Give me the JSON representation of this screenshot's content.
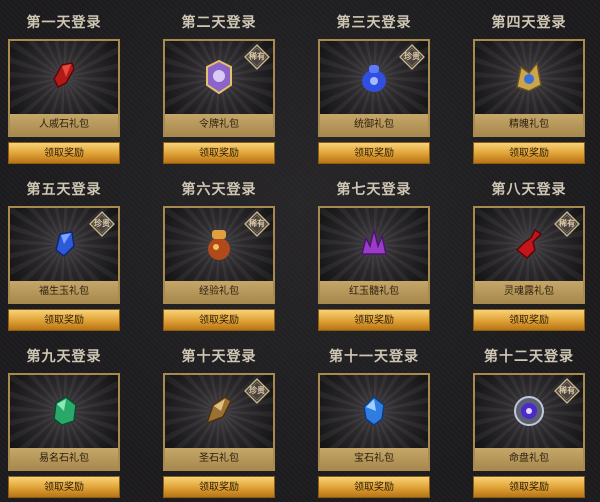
{
  "rewards": [
    {
      "day": "第一天登录",
      "item": "人戚石礼包",
      "badge": "",
      "icon": "red-gem-icon",
      "claim": "领取奖励"
    },
    {
      "day": "第二天登录",
      "item": "令牌礼包",
      "badge": "稀有",
      "icon": "token-icon",
      "claim": "领取奖励"
    },
    {
      "day": "第三天登录",
      "item": "统御礼包",
      "badge": "珍贵",
      "icon": "blue-pouch-icon",
      "claim": "领取奖励"
    },
    {
      "day": "第四天登录",
      "item": "精魄礼包",
      "badge": "",
      "icon": "golden-spirit-icon",
      "claim": "领取奖励"
    },
    {
      "day": "第五天登录",
      "item": "福生玉礼包",
      "badge": "珍贵",
      "icon": "blue-jade-icon",
      "claim": "领取奖励"
    },
    {
      "day": "第六天登录",
      "item": "经验礼包",
      "badge": "稀有",
      "icon": "exp-jar-icon",
      "claim": "领取奖励"
    },
    {
      "day": "第七天登录",
      "item": "红玉髓礼包",
      "badge": "",
      "icon": "purple-crystal-icon",
      "claim": "领取奖励"
    },
    {
      "day": "第八天登录",
      "item": "灵魂露礼包",
      "badge": "稀有",
      "icon": "red-bottle-icon",
      "claim": "领取奖励"
    },
    {
      "day": "第九天登录",
      "item": "易名石礼包",
      "badge": "",
      "icon": "green-stone-icon",
      "claim": "领取奖励"
    },
    {
      "day": "第十天登录",
      "item": "圣石礼包",
      "badge": "珍贵",
      "icon": "holy-stone-icon",
      "claim": "领取奖励"
    },
    {
      "day": "第十一天登录",
      "item": "宝石礼包",
      "badge": "",
      "icon": "blue-gem-icon",
      "claim": "领取奖励"
    },
    {
      "day": "第十二天登录",
      "item": "命盘礼包",
      "badge": "稀有",
      "icon": "fate-disc-icon",
      "claim": "领取奖励"
    }
  ],
  "colors": {
    "border": "#a88a50",
    "button": "#e2a63a",
    "badge": "#4a4240"
  }
}
